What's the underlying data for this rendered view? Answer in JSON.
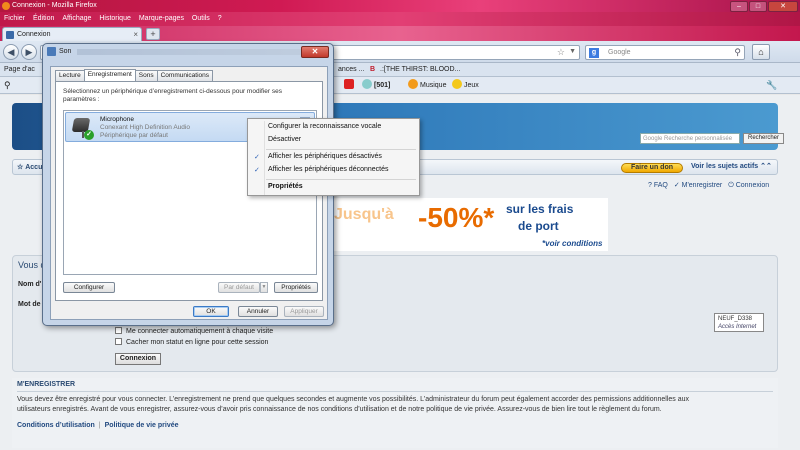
{
  "browser": {
    "window_title": "Connexion - Mozilla Firefox",
    "menu": [
      "Fichier",
      "Édition",
      "Affichage",
      "Historique",
      "Marque-pages",
      "Outils",
      "?"
    ],
    "tab_title": "Connexion",
    "new_tab_symbol": "+",
    "search_placeholder": "Google",
    "bookmarks": {
      "first": "Page d'ac",
      "trail": "ances ...",
      "thirst": ".:[THE THIRST: BLOOD..."
    },
    "toolbar2": {
      "count": "[501]",
      "musique": "Musique",
      "jeux": "Jeux"
    }
  },
  "forum": {
    "search_placeholder": "Google Recherche personnalisée",
    "search_button": "Rechercher",
    "nav_label": "Accu",
    "donate_button": "Faire un don",
    "see_active": "Voir les sujets actifs",
    "links": [
      "FAQ",
      "M'enregistrer",
      "Connexion"
    ],
    "promo": {
      "line1": "Jusqu'à",
      "big": "-50%*",
      "line2": "sur les frais",
      "line3": "de port",
      "note": "*voir conditions"
    },
    "login": {
      "heading": "Vous d",
      "username_label": "Nom d'",
      "password_label": "Mot de",
      "remember": "Me connecter automatiquement à chaque visite",
      "hide": "Cacher mon statut en ligne pour cette session",
      "submit": "Connexion"
    },
    "register": {
      "heading": "M'ENREGISTRER",
      "text": "Vous devez être enregistré pour vous connecter. L’enregistrement ne prend que quelques secondes et augmente vos possibilités. L’administrateur du forum peut également accorder des permissions additionnelles aux utilisateurs enregistrés. Avant de vous enregistrer, assurez-vous d’avoir pris connaissance de nos conditions d’utilisation et de notre politique de vie privée. Assurez-vous de bien lire tout le règlement du forum.",
      "terms_link": "Conditions d’utilisation",
      "privacy_link": "Politique de vie privée"
    }
  },
  "network_tooltip": {
    "name": "NEUF_D338",
    "status": "Accès Internet"
  },
  "dialog": {
    "title": "Son",
    "close_symbol": "✕",
    "tabs": [
      "Lecture",
      "Enregistrement",
      "Sons",
      "Communications"
    ],
    "active_tab": "Enregistrement",
    "description": "Sélectionnez un périphérique d’enregistrement ci-dessous pour modifier ses paramètres :",
    "device": {
      "name": "Microphone",
      "driver": "Conexant High Definition Audio",
      "status": "Périphérique par défaut"
    },
    "buttons": {
      "configure": "Configurer",
      "default": "Par défaut",
      "properties": "Propriétés",
      "ok": "OK",
      "cancel": "Annuler",
      "apply": "Appliquer"
    }
  },
  "context_menu": {
    "items": [
      {
        "label": "Configurer la reconnaissance vocale",
        "checked": false,
        "bold": false
      },
      {
        "label": "Désactiver",
        "checked": false,
        "bold": false
      },
      {
        "label": "Afficher les périphériques désactivés",
        "checked": true,
        "bold": false
      },
      {
        "label": "Afficher les périphériques déconnectés",
        "checked": true,
        "bold": false
      },
      {
        "label": "Propriétés",
        "checked": false,
        "bold": true
      }
    ],
    "check_symbol": "✓"
  }
}
